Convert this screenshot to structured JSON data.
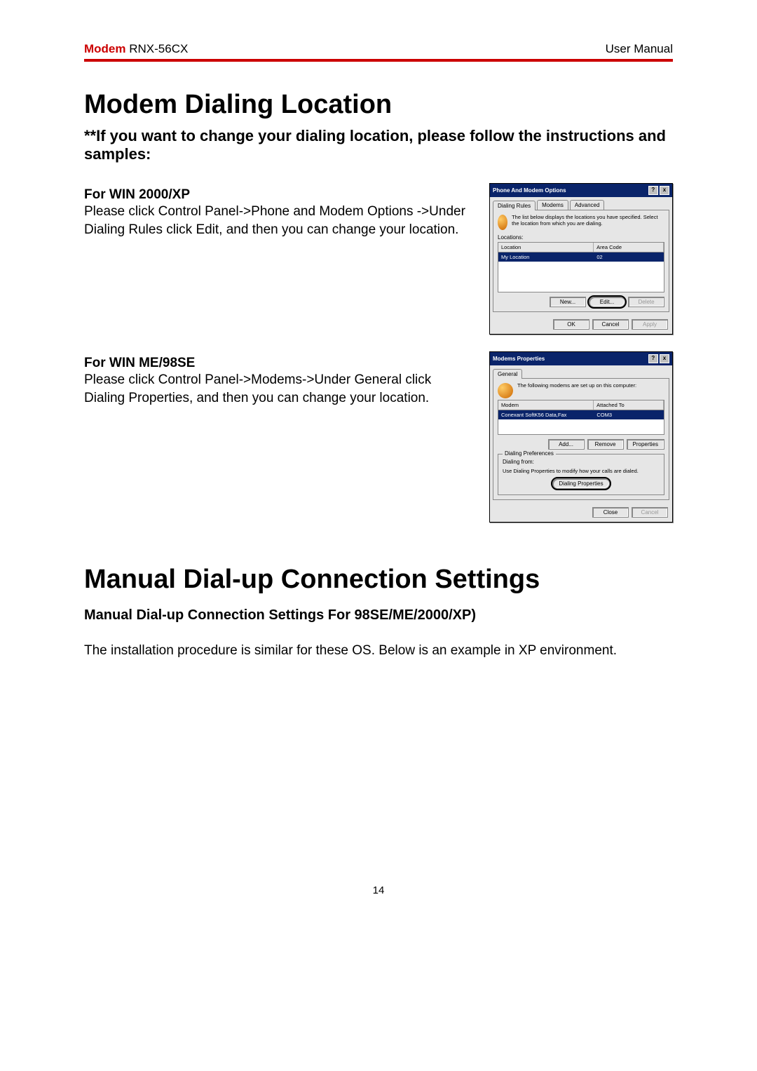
{
  "header": {
    "brand": "Modem",
    "model": "RNX-56CX",
    "right": "User Manual"
  },
  "section1": {
    "title": "Modem Dialing Location",
    "subtitle": "**If you want to change your dialing location, please follow the instructions and samples:"
  },
  "win2000": {
    "title": "For WIN 2000/XP",
    "body": "Please click Control Panel->Phone and Modem Options ->Under Dialing Rules click Edit, and then you can change your location."
  },
  "winme": {
    "title": "For WIN ME/98SE",
    "body": "Please click Control Panel->Modems->Under General click Dialing Properties, and then you can change your location."
  },
  "dlg1": {
    "title": "Phone And Modem Options",
    "tabs": [
      "Dialing Rules",
      "Modems",
      "Advanced"
    ],
    "desc": "The list below displays the locations you have specified. Select the location from which you are dialing.",
    "locations_label": "Locations:",
    "cols": [
      "Location",
      "Area Code"
    ],
    "row": [
      "My Location",
      "02"
    ],
    "btns": [
      "New...",
      "Edit...",
      "Delete"
    ],
    "footer": [
      "OK",
      "Cancel",
      "Apply"
    ]
  },
  "dlg2": {
    "title": "Modems Properties",
    "tab": "General",
    "desc": "The following modems are set up on this computer:",
    "cols": [
      "Modem",
      "Attached To"
    ],
    "row": [
      "Conexant SoftK56 Data,Fax",
      "COM3"
    ],
    "btns": [
      "Add...",
      "Remove",
      "Properties"
    ],
    "group_title": "Dialing Preferences",
    "dialing_from": "Dialing from:",
    "group_desc": "Use Dialing Properties to modify how your calls are dialed.",
    "group_btn": "Dialing Properties",
    "footer": [
      "Close",
      "Cancel"
    ]
  },
  "section2": {
    "title": "Manual Dial-up Connection Settings",
    "subtitle": "Manual Dial-up Connection Settings For 98SE/ME/2000/XP)",
    "body": "The installation procedure is similar for these OS. Below is an example in XP environment."
  },
  "page_number": "14"
}
